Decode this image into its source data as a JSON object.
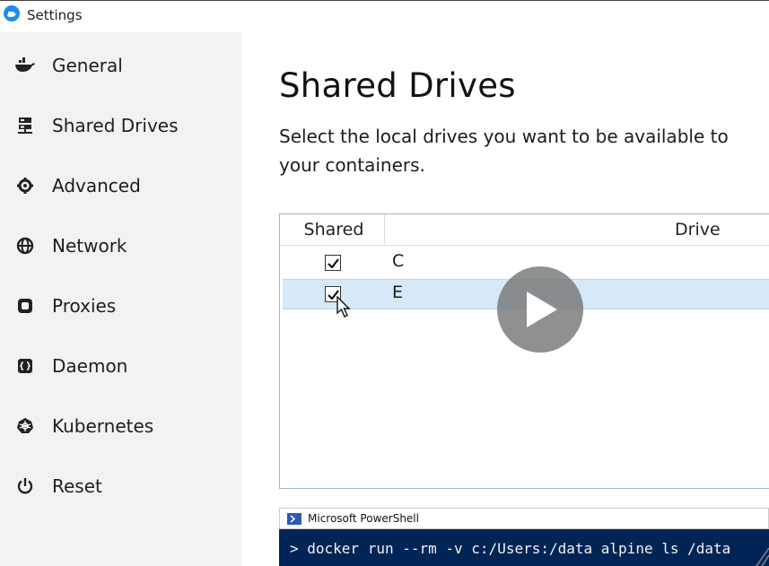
{
  "window": {
    "title": "Settings"
  },
  "sidebar": {
    "items": [
      {
        "label": "General",
        "icon": "docker-whale-icon"
      },
      {
        "label": "Shared Drives",
        "icon": "shared-drives-icon"
      },
      {
        "label": "Advanced",
        "icon": "gear-icon"
      },
      {
        "label": "Network",
        "icon": "globe-icon"
      },
      {
        "label": "Proxies",
        "icon": "proxies-icon"
      },
      {
        "label": "Daemon",
        "icon": "daemon-icon"
      },
      {
        "label": "Kubernetes",
        "icon": "kubernetes-icon"
      },
      {
        "label": "Reset",
        "icon": "power-icon"
      }
    ]
  },
  "main": {
    "title": "Shared Drives",
    "description": "Select the local drives you want to be available to your containers.",
    "table": {
      "columns": [
        "Shared",
        "Drive"
      ],
      "rows": [
        {
          "drive": "C",
          "shared": true
        },
        {
          "drive": "E",
          "shared": true
        }
      ]
    }
  },
  "powershell": {
    "title": "Microsoft PowerShell",
    "command": "> docker run --rm -v c:/Users:/data alpine ls /data"
  },
  "colors": {
    "accent": "#1d8ded",
    "sidebar_bg": "#f2f2f2",
    "selected_row": "#d6e9f9",
    "powershell_bg": "#012456"
  }
}
